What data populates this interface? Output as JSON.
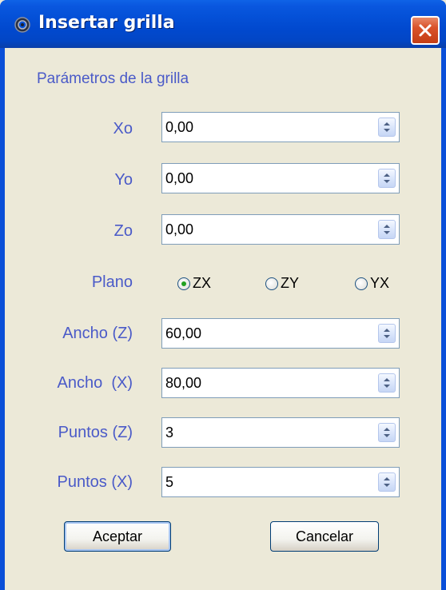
{
  "window": {
    "title": "Insertar grilla",
    "icon": "gear-icon",
    "close_icon": "close-icon",
    "colors": {
      "titlebar": "#0552d9",
      "close_button": "#d9522a",
      "dialog_background": "#ece9d8",
      "label_text": "#4a5ac8",
      "radio_selected_dot": "#21a121"
    }
  },
  "section": {
    "title": "Parámetros de la grilla"
  },
  "fields": {
    "xo": {
      "label": "Xo",
      "value": "0,00"
    },
    "yo": {
      "label": "Yo",
      "value": "0,00"
    },
    "zo": {
      "label": "Zo",
      "value": "0,00"
    },
    "ancho_z": {
      "label": "Ancho (Z)",
      "value": "60,00"
    },
    "ancho_x": {
      "label": "Ancho  (X)",
      "value": "80,00"
    },
    "puntos_z": {
      "label": "Puntos (Z)",
      "value": "3"
    },
    "puntos_x": {
      "label": "Puntos (X)",
      "value": "5"
    }
  },
  "plano": {
    "label": "Plano",
    "options": [
      "ZX",
      "ZY",
      "YX"
    ],
    "selected": "ZX"
  },
  "buttons": {
    "accept": "Aceptar",
    "cancel": "Cancelar"
  }
}
